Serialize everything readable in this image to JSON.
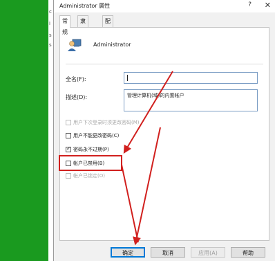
{
  "window": {
    "title": "Administrator 属性",
    "help_icon": "?",
    "close_icon": "✕"
  },
  "tabs": [
    {
      "label": "常规"
    },
    {
      "label": "隶属于"
    },
    {
      "label": "配置文件"
    }
  ],
  "user": {
    "name": "Administrator",
    "icon": "user-icon"
  },
  "form": {
    "fullname_label": "全名(F):",
    "fullname_value": "",
    "description_label": "描述(D):",
    "description_value": "管理计算机(域)的内置帐户"
  },
  "checkboxes": [
    {
      "label": "用户下次登录时须更改密码(M)",
      "checked": false,
      "enabled": false
    },
    {
      "label": "用户不能更改密码(C)",
      "checked": false,
      "enabled": true
    },
    {
      "label": "密码永不过期(P)",
      "checked": true,
      "enabled": true
    },
    {
      "label": "帐户已禁用(B)",
      "checked": false,
      "enabled": true
    },
    {
      "label": "帐户已锁定(O)",
      "checked": false,
      "enabled": false
    }
  ],
  "buttons": {
    "ok": "确定",
    "cancel": "取消",
    "apply": "应用(A)",
    "help": "帮助"
  },
  "left_strip_chars": [
    "c",
    "i",
    "s",
    "s"
  ],
  "colors": {
    "annotation": "#d1201e",
    "left_background": "#1a9a1f",
    "focus_border": "#0078d7"
  }
}
